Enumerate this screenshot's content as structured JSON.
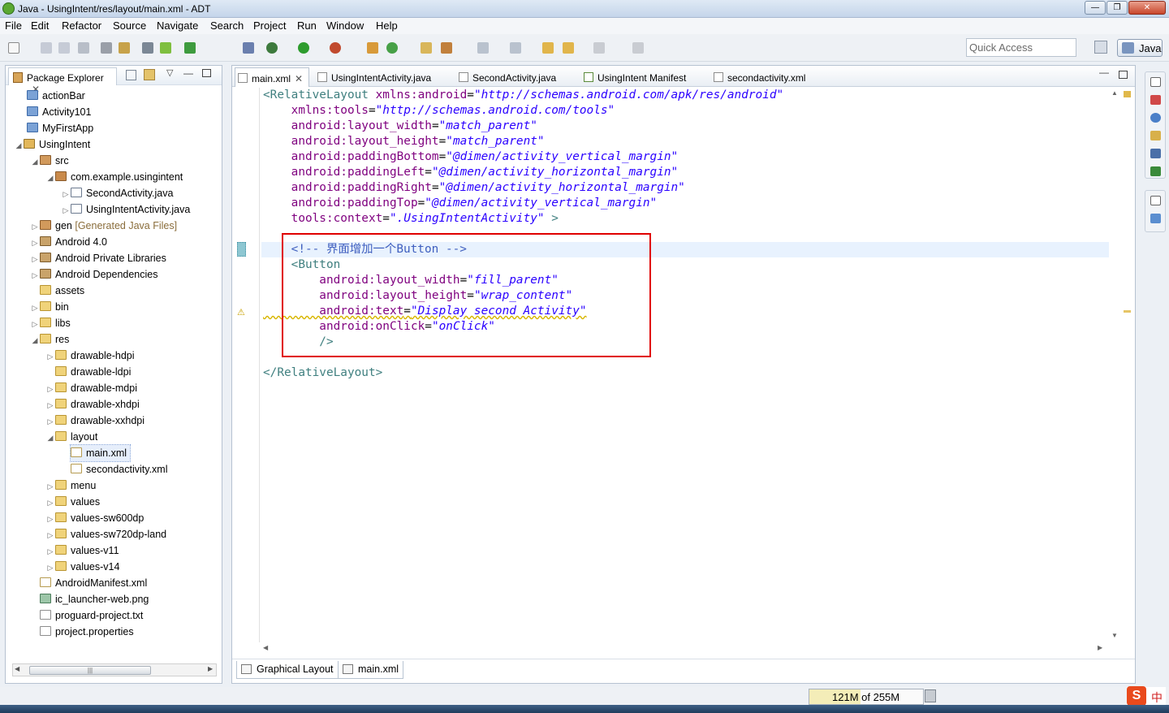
{
  "window": {
    "title": "Java - UsingIntent/res/layout/main.xml - ADT"
  },
  "menu": [
    "File",
    "Edit",
    "Refactor",
    "Source",
    "Navigate",
    "Search",
    "Project",
    "Run",
    "Window",
    "Help"
  ],
  "toolbar": {
    "quick_access_placeholder": "Quick Access",
    "perspective_label": "Java"
  },
  "package_explorer": {
    "tab_label": "Package Explorer",
    "items": [
      {
        "label": "actionBar"
      },
      {
        "label": "Activity101"
      },
      {
        "label": "MyFirstApp"
      },
      {
        "label": "UsingIntent"
      },
      {
        "label": "src"
      },
      {
        "label": "com.example.usingintent"
      },
      {
        "label": "SecondActivity.java"
      },
      {
        "label": "UsingIntentActivity.java"
      },
      {
        "label": "gen",
        "suffix": "[Generated Java Files]"
      },
      {
        "label": "Android 4.0"
      },
      {
        "label": "Android Private Libraries"
      },
      {
        "label": "Android Dependencies"
      },
      {
        "label": "assets"
      },
      {
        "label": "bin"
      },
      {
        "label": "libs"
      },
      {
        "label": "res"
      },
      {
        "label": "drawable-hdpi"
      },
      {
        "label": "drawable-ldpi"
      },
      {
        "label": "drawable-mdpi"
      },
      {
        "label": "drawable-xhdpi"
      },
      {
        "label": "drawable-xxhdpi"
      },
      {
        "label": "layout"
      },
      {
        "label": "main.xml"
      },
      {
        "label": "secondactivity.xml"
      },
      {
        "label": "menu"
      },
      {
        "label": "values"
      },
      {
        "label": "values-sw600dp"
      },
      {
        "label": "values-sw720dp-land"
      },
      {
        "label": "values-v11"
      },
      {
        "label": "values-v14"
      },
      {
        "label": "AndroidManifest.xml"
      },
      {
        "label": "ic_launcher-web.png"
      },
      {
        "label": "proguard-project.txt"
      },
      {
        "label": "project.properties"
      }
    ]
  },
  "editor": {
    "tabs": [
      {
        "label": "main.xml"
      },
      {
        "label": "UsingIntentActivity.java"
      },
      {
        "label": "SecondActivity.java"
      },
      {
        "label": "UsingIntent Manifest"
      },
      {
        "label": "secondactivity.xml"
      }
    ],
    "code": {
      "l1_tag": "<RelativeLayout",
      "l1_att": " xmlns:android",
      "l1_val": "\"http://schemas.android.com/apk/res/android\"",
      "l2_att": "    xmlns:tools",
      "l2_val": "\"http://schemas.android.com/tools\"",
      "l3_att": "    android:layout_width",
      "l3_val": "\"match_parent\"",
      "l4_att": "    android:layout_height",
      "l4_val": "\"match_parent\"",
      "l5_att": "    android:paddingBottom",
      "l5_val": "\"@dimen/activity_vertical_margin\"",
      "l6_att": "    android:paddingLeft",
      "l6_val": "\"@dimen/activity_horizontal_margin\"",
      "l7_att": "    android:paddingRight",
      "l7_val": "\"@dimen/activity_horizontal_margin\"",
      "l8_att": "    android:paddingTop",
      "l8_val": "\"@dimen/activity_vertical_margin\"",
      "l9_att": "    tools:context",
      "l9_val": "\".UsingIntentActivity\"",
      "l9_tag": " >",
      "l11_cmt": "    <!-- 界面增加一个Button -->",
      "l12_tag": "    <Button",
      "l13_att": "        android:layout_width",
      "l13_val": "\"fill_parent\"",
      "l14_att": "        android:layout_height",
      "l14_val": "\"wrap_content\"",
      "l15_att": "        android:text",
      "l15_val": "\"Display second Activity\"",
      "l16_att": "        android:onClick",
      "l16_val": "\"onClick\"",
      "l17_tag": "        />",
      "l19_tag": "</RelativeLayout>"
    },
    "bottom_tabs": [
      {
        "label": "Graphical Layout"
      },
      {
        "label": "main.xml"
      }
    ]
  },
  "status": {
    "heap_used": "121M",
    "heap_rest": " of 255M"
  },
  "ime": {
    "logo": "S",
    "mode": "中"
  }
}
